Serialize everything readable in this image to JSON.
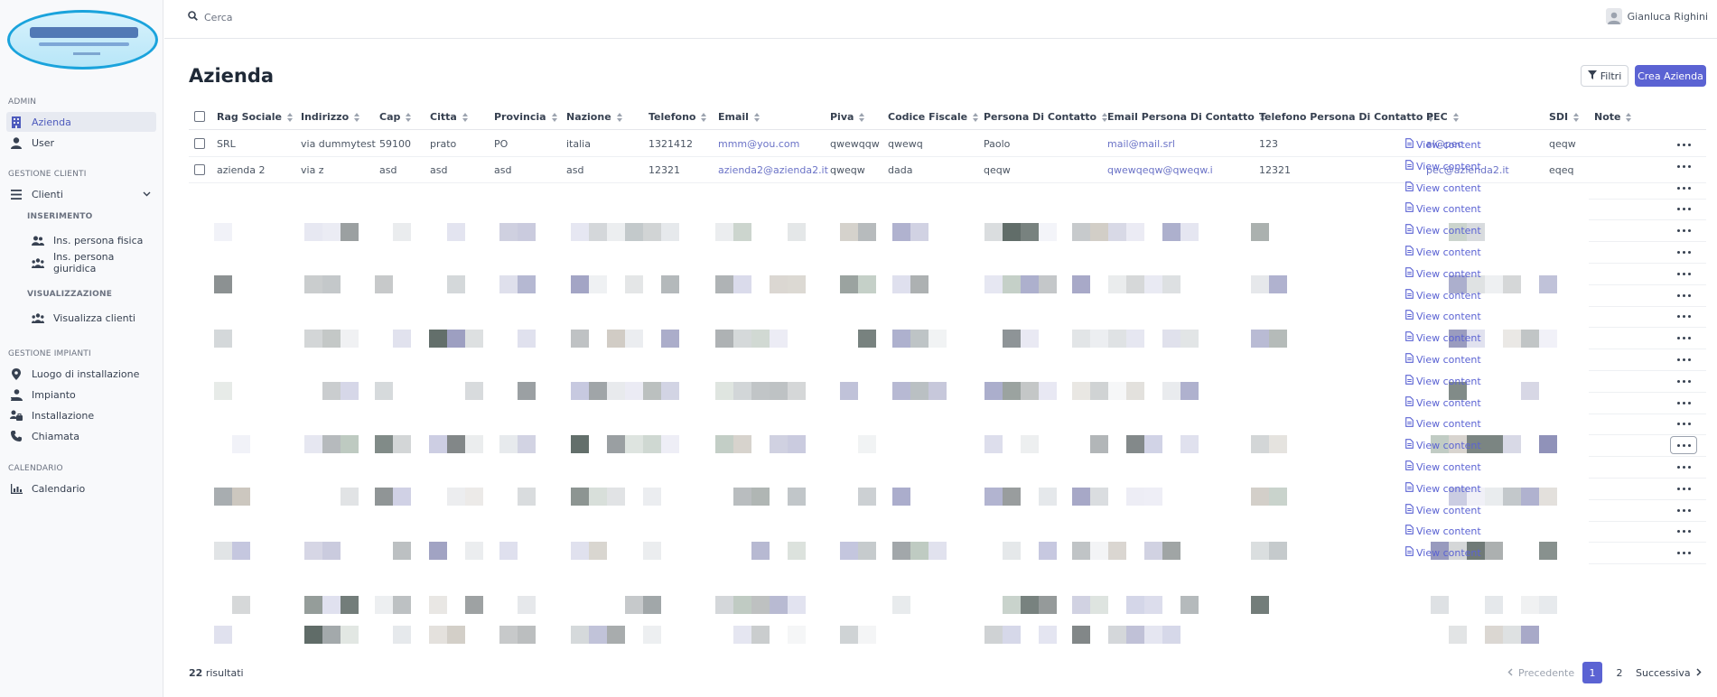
{
  "sidebar": {
    "sections": [
      {
        "title": "ADMIN"
      },
      {
        "title": "GESTIONE CLIENTI"
      },
      {
        "title": "GESTIONE IMPIANTI"
      },
      {
        "title": "CALENDARIO"
      }
    ],
    "subsections": [
      {
        "title": "INSERIMENTO"
      },
      {
        "title": "VISUALIZZAZIONE"
      }
    ],
    "items": [
      {
        "label": "Azienda",
        "icon": "building-icon"
      },
      {
        "label": "User",
        "icon": "user-icon"
      },
      {
        "label": "Clienti",
        "icon": "menu-icon"
      },
      {
        "label": "Ins. persona fisica",
        "icon": "users-icon"
      },
      {
        "label": "Ins. persona giuridica",
        "icon": "users-group-icon"
      },
      {
        "label": "Visualizza clienti",
        "icon": "users-icon"
      },
      {
        "label": "Luogo di installazione",
        "icon": "map-pin-icon"
      },
      {
        "label": "Impianto",
        "icon": "user-tie-icon"
      },
      {
        "label": "Installazione",
        "icon": "toolbox-icon"
      },
      {
        "label": "Chiamata",
        "icon": "phone-icon"
      },
      {
        "label": "Calendario",
        "icon": "chart-icon"
      }
    ]
  },
  "topbar": {
    "search_placeholder": "Cerca",
    "user_name": "Gianluca Righini"
  },
  "page": {
    "title": "Azienda",
    "filter_label": "Filtri",
    "create_label": "Crea Azienda"
  },
  "table": {
    "columns": [
      "Rag Sociale",
      "Indirizzo",
      "Cap",
      "Citta",
      "Provincia",
      "Nazione",
      "Telefono",
      "Email",
      "Piva",
      "Codice Fiscale",
      "Persona Di Contatto",
      "Email Persona Di Contatto",
      "Telefono Persona Di Contatto",
      "PEC",
      "SDI",
      "Note"
    ],
    "rows": [
      [
        "SRL",
        "via dummytest",
        "59100",
        "prato",
        "PO",
        "italia",
        "1321412",
        "mmm@you.com",
        "qwewqqw",
        "qwewq",
        "Paolo",
        "mail@mail.srl",
        "123",
        "al@pec",
        "qeqw"
      ],
      [
        "azienda 2",
        "via z",
        "asd",
        "asd",
        "asd",
        "asd",
        "12321",
        "azienda2@azienda2.it",
        "qweqw",
        "dada",
        "qeqw",
        "qwewqeqw@qweqw.i",
        "12321",
        "pec@azienda2.it",
        "eqeq"
      ]
    ],
    "view_content_label": "View content"
  },
  "footer": {
    "results_count": "22",
    "results_label": "risultati",
    "prev_label": "Precedente",
    "pages": [
      "1",
      "2"
    ],
    "current_page": "1",
    "next_label": "Successiva"
  },
  "colors": {
    "accent": "#5b63d3",
    "sidebar_bg": "#f8f9fb",
    "active_bg": "#e7eaf1",
    "logo_border": "#1aa3dc"
  }
}
